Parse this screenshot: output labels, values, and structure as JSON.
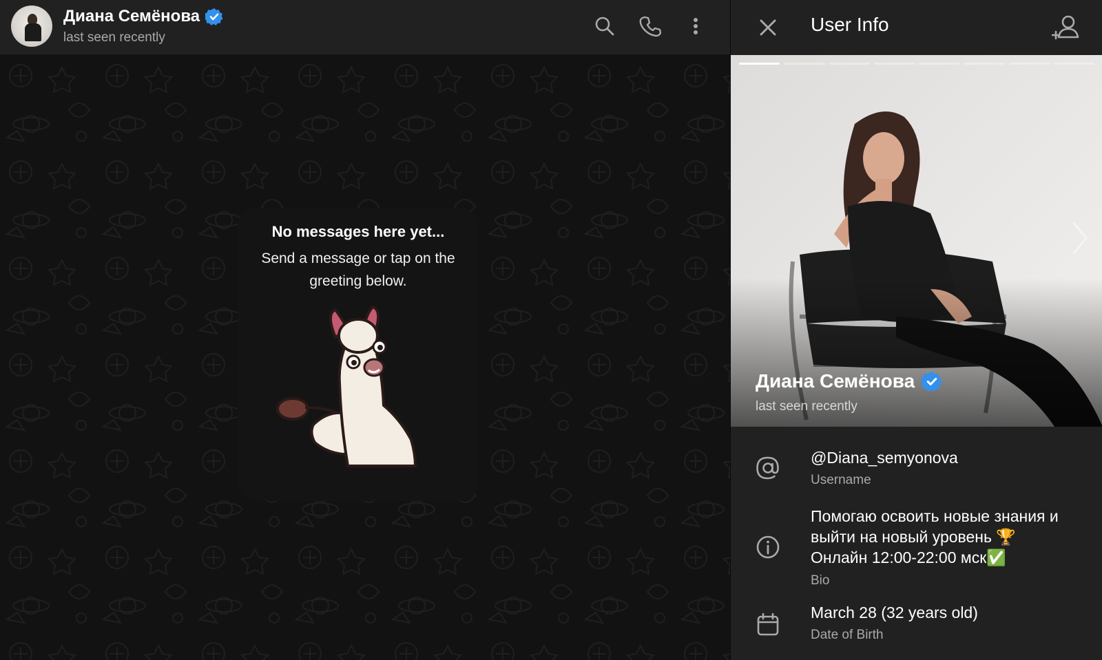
{
  "chat": {
    "name": "Диана Семёнова",
    "status": "last seen recently",
    "empty": {
      "title": "No messages here yet...",
      "text": "Send a message or tap on the greeting below."
    }
  },
  "icons": {
    "search": "search-icon",
    "call": "phone-icon",
    "more": "more-vertical-icon",
    "close": "close-icon",
    "add_contact": "add-contact-icon",
    "verified": "verified-badge-icon",
    "username": "at-sign-icon",
    "bio": "info-icon",
    "birthday": "calendar-icon"
  },
  "panel": {
    "title": "User Info",
    "photo": {
      "name": "Диана Семёнова",
      "status": "last seen recently",
      "photo_count": 8,
      "current_photo": 1
    },
    "username": {
      "value": "@Diana_semyonova",
      "label": "Username"
    },
    "bio": {
      "line1": "Помогаю освоить новые знания и",
      "line2": "выйти на новый уровень 🏆",
      "line3": "Онлайн 12:00-22:00 мск✅",
      "label": "Bio"
    },
    "birthday": {
      "value": "March 28 (32 years old)",
      "label": "Date of Birth"
    }
  },
  "colors": {
    "accent": "#3390ec",
    "header_bg": "#212121",
    "chat_bg": "#121212",
    "secondary_text": "#aaaaaa"
  }
}
